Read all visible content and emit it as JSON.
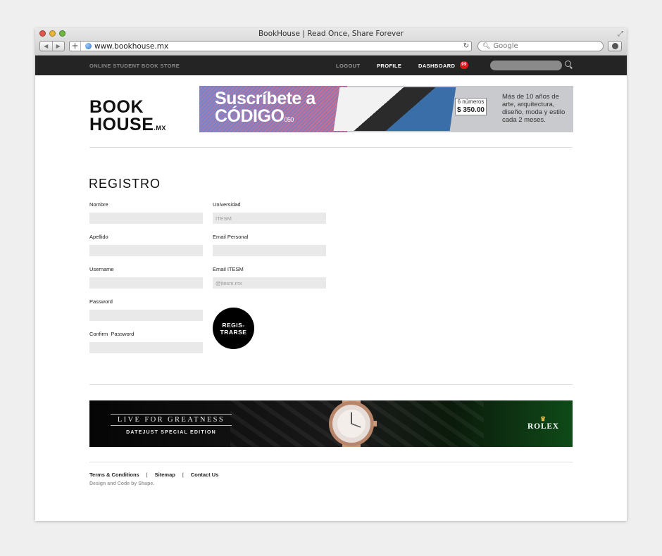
{
  "browser": {
    "window_title": "BookHouse | Read Once, Share Forever",
    "url": "www.bookhouse.mx",
    "search_placeholder": "Google",
    "back_glyph": "◀",
    "forward_glyph": "▶",
    "new_tab_glyph": "+",
    "reload_glyph": "↻"
  },
  "topnav": {
    "tagline": "ONLINE STUDENT BOOK STORE",
    "logout": "LOGOUT",
    "profile": "PROFILE",
    "dashboard": "DASHBOARD",
    "badge_count": "99"
  },
  "logo": {
    "line1": "BOOK",
    "line2": "HOUSE",
    "suffix": ".MX"
  },
  "ad_codigo": {
    "headline1": "Suscríbete a",
    "headline2": "CÓDIGO",
    "headline2_suffix": "050",
    "issues": "6 números",
    "price": "$ 350.00",
    "copy": "Más de 10 años de arte, arquitectura, diseño, moda y estilo cada 2 meses."
  },
  "form": {
    "title": "REGISTRO",
    "fields": {
      "nombre": {
        "label": "Nombre",
        "value": ""
      },
      "apellido": {
        "label": "Apellido",
        "value": ""
      },
      "username": {
        "label": "Username",
        "value": ""
      },
      "password": {
        "label": "Password",
        "value": ""
      },
      "confirm_password": {
        "label": "Confirm  Password",
        "value": ""
      },
      "universidad": {
        "label": "Universidad",
        "placeholder": "ITESM"
      },
      "email_personal": {
        "label": "Email Personal",
        "value": ""
      },
      "email_itesm": {
        "label": "Email ITESM",
        "placeholder": "@itesm.mx"
      }
    },
    "submit_line1": "REGIS-",
    "submit_line2": "TRARSE"
  },
  "ad_rolex": {
    "tagline": "LIVE FOR GREATNESS",
    "subline": "DATEJUST SPECIAL EDITION",
    "brand": "ROLEX"
  },
  "footer": {
    "links": [
      "Terms & Conditions",
      "Sitemap",
      "Contact Us"
    ],
    "separator": "|",
    "credit": "Design and Code by Shape."
  },
  "colors": {
    "topnav_bg": "#242424",
    "badge": "#e01818",
    "input_bg": "#e9e9e9",
    "button": "#000000"
  }
}
